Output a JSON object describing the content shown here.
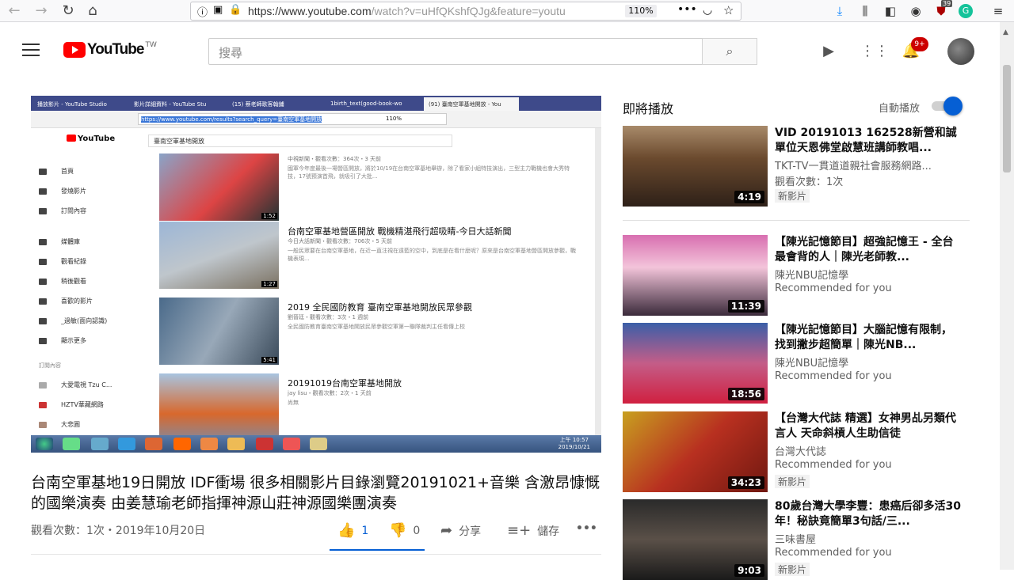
{
  "browser": {
    "url_main": "https://www.youtube.com",
    "url_rest": "/watch?v=uHfQKshfQJg&feature=youtu",
    "zoom": "110%",
    "ext_badge": "39"
  },
  "header": {
    "logo_text": "YouTube",
    "logo_region": "TW",
    "search_placeholder": "搜尋",
    "notification_count": "9+"
  },
  "player": {
    "tabs": [
      "播放影片 - YouTube Studio",
      "影片詳細資料 - YouTube Stu",
      "(15) 蔡老師歌客翰鋪",
      "1birth_text(good-book-wo",
      "(91) 臺南空軍基地開放 - You"
    ],
    "inner_url": "https://www.youtube.com/results?search_query=臺南空軍基地開放",
    "inner_zoom": "110%",
    "inner_logo": "YouTube",
    "inner_search": "臺南空軍基地開放",
    "sidebar": [
      "首頁",
      "發燒影片",
      "訂閱內容",
      "媒體庫",
      "觀看紀錄",
      "稍後觀看",
      "喜歡的影片",
      "_過敏(面向認識)",
      "顯示更多",
      "訂閱內容",
      "大愛電視 Tzu C...",
      "HZTV華藏網路",
      "大悲圓"
    ],
    "results": [
      {
        "title": "",
        "meta": "中視新聞・觀看次數：364次・3 天前",
        "desc": "國軍今年度最後一場營區開放，將於10/19在台南空軍基地舉辦，除了看家小組特技演出，三型主力戰機也會大秀特技，17號預演首飛，就吸引了大批...",
        "dur": "1:52"
      },
      {
        "title": "台南空軍基地營區開放 戰機精湛飛行超吸睛-今日大話新聞",
        "meta": "今日大話新聞・觀看次數：706次・5 天前",
        "desc": "一般民眾要在台南空軍基地，在近一直注視在遠藍的空中，到底是在看什麼呢？原來是台南空軍基地營區開放參觀，戰機表現...",
        "dur": "1:27"
      },
      {
        "title": "2019 全民國防教育 臺南空軍基地開放民眾參觀",
        "meta": "劉晉廷・觀看次數：3次・1 週前",
        "desc": "全民國防教育臺南空軍基地開放民眾參觀空軍第一聯隊裁判主任看傳上校",
        "dur": "5:41"
      },
      {
        "title": "20191019台南空軍基地開放",
        "meta": "jay lisu・觀看次數：2次・1 天前",
        "desc": "尚無",
        "dur": ""
      }
    ],
    "clock_time": "上午 10:57",
    "clock_date": "2019/10/21"
  },
  "video": {
    "title": "台南空軍基地19日開放 IDF衝場 很多相關影片目錄瀏覽20191021+音樂 含激昂慷慨的國樂演奏 由姜慧瑜老師指揮神源山莊神源國樂團演奏",
    "meta": "觀看次數：1次・2019年10月20日",
    "likes": "1",
    "dislikes": "0",
    "share_label": "分享",
    "save_label": "儲存",
    "more_label": "•••"
  },
  "up_next": {
    "heading": "即將播放",
    "autoplay_label": "自動播放",
    "autoplay_on": true,
    "items": [
      {
        "title": "VID 20191013 162528新營和誠單位天恩佛堂啟慧班講師教唱...",
        "channel": "TKT-TV一貫道道親社會服務網路...",
        "sub": "觀看次數：1次",
        "badge": "新影片",
        "dur": "4:19"
      },
      {
        "title": "【陳光記憶節目】超強記憶王 - 全台最會背的人｜陳光老師教...",
        "channel": "陳光NBU記憶學",
        "sub": "Recommended for you",
        "badge": "",
        "dur": "11:39"
      },
      {
        "title": "【陳光記憶節目】大腦記憶有限制，找到撇步超簡單｜陳光NB...",
        "channel": "陳光NBU記憶學",
        "sub": "Recommended for you",
        "badge": "",
        "dur": "18:56"
      },
      {
        "title": "【台灣大代誌 精選】女神男乩另類代言人 天命斜槓人生助信徒",
        "channel": "台灣大代誌",
        "sub": "Recommended for you",
        "badge": "新影片",
        "dur": "34:23"
      },
      {
        "title": "80歲台灣大學李豐：患癌后卻多活30年！秘訣竟簡單3句話/三...",
        "channel": "三味書屋",
        "sub": "Recommended for you",
        "badge": "新影片",
        "dur": "9:03"
      }
    ]
  },
  "colors": {
    "brand_red": "#ff0000",
    "accent_blue": "#065fd4"
  }
}
